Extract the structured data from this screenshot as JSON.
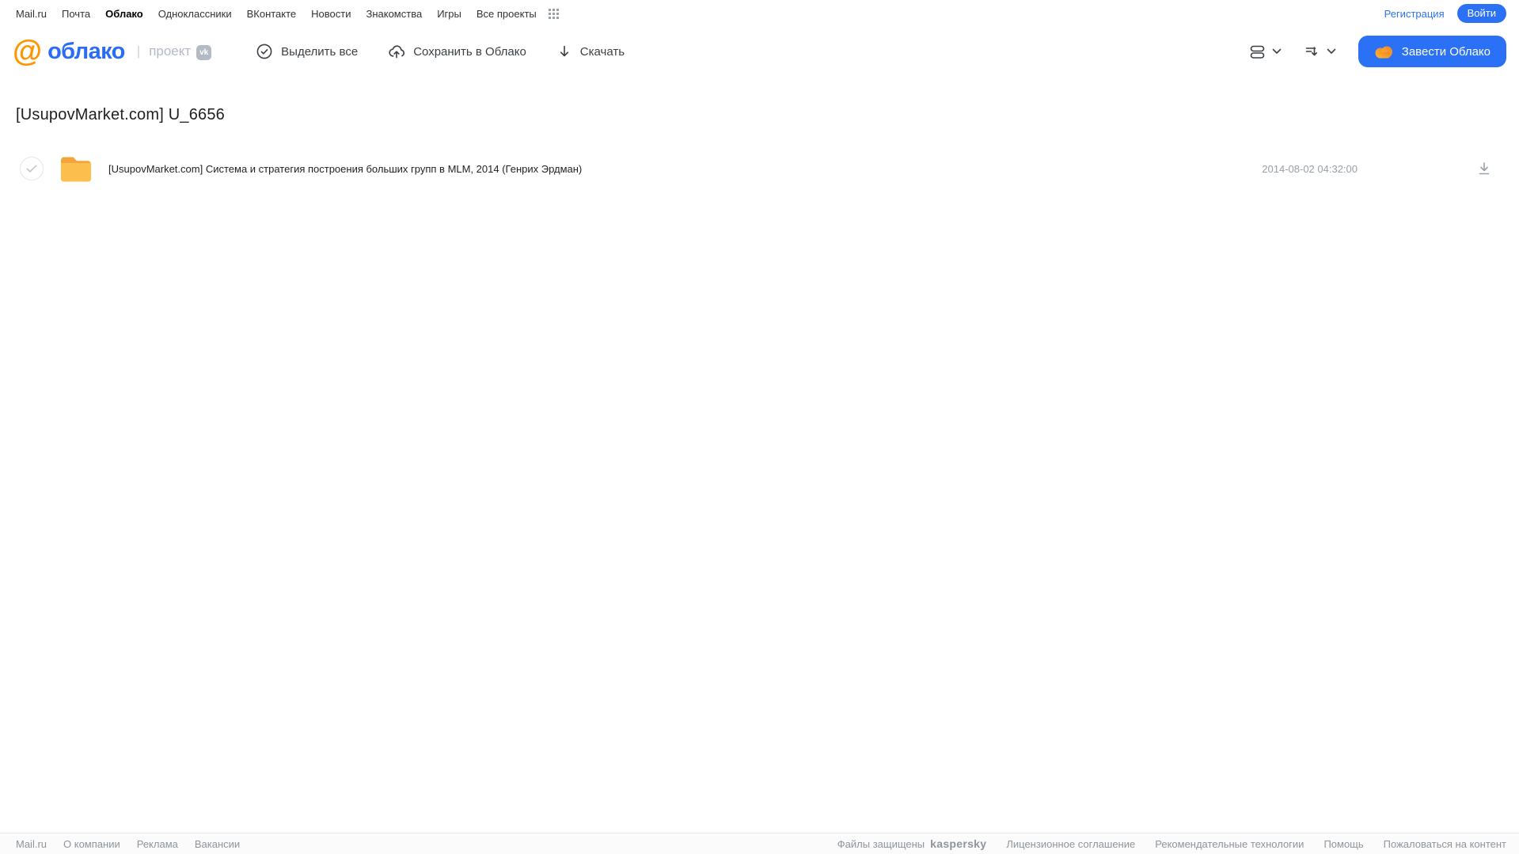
{
  "topnav": {
    "items": [
      "Mail.ru",
      "Почта",
      "Облако",
      "Одноклассники",
      "ВКонтакте",
      "Новости",
      "Знакомства",
      "Игры",
      "Все проекты"
    ],
    "active_item": "Облако",
    "registration_label": "Регистрация",
    "login_label": "Войти"
  },
  "header": {
    "logo_at": "@",
    "logo_text": "облако",
    "logo_divider": "|",
    "project_label": "проект",
    "project_badge": "vk",
    "toolbar": {
      "select_all": "Выделить все",
      "save_to_cloud": "Сохранить в Облако",
      "download": "Скачать"
    },
    "get_cloud_button": "Завести Облако"
  },
  "main": {
    "title": "[UsupovMarket.com] U_6656",
    "files": [
      {
        "type": "folder",
        "name": "[UsupovMarket.com] Система и стратегия построения больших групп в MLM, 2014 (Генрих Эрдман)",
        "date": "2014-08-02 04:32:00"
      }
    ]
  },
  "footer": {
    "left_links": [
      "Mail.ru",
      "О компании",
      "Реклама",
      "Вакансии"
    ],
    "protected_label": "Файлы защищены",
    "kaspersky_label": "kaspersky",
    "right_links": [
      "Лицензионное соглашение",
      "Рекомендательные технологии",
      "Помощь",
      "Пожаловаться на контент"
    ]
  },
  "colors": {
    "accent_blue": "#2b71f6",
    "logo_orange": "#ff9500",
    "logo_blue": "#2b6cf6",
    "kaspersky_teal": "#00846b",
    "folder_yellow": "#fcbf4d",
    "folder_tab": "#f2a53a"
  }
}
